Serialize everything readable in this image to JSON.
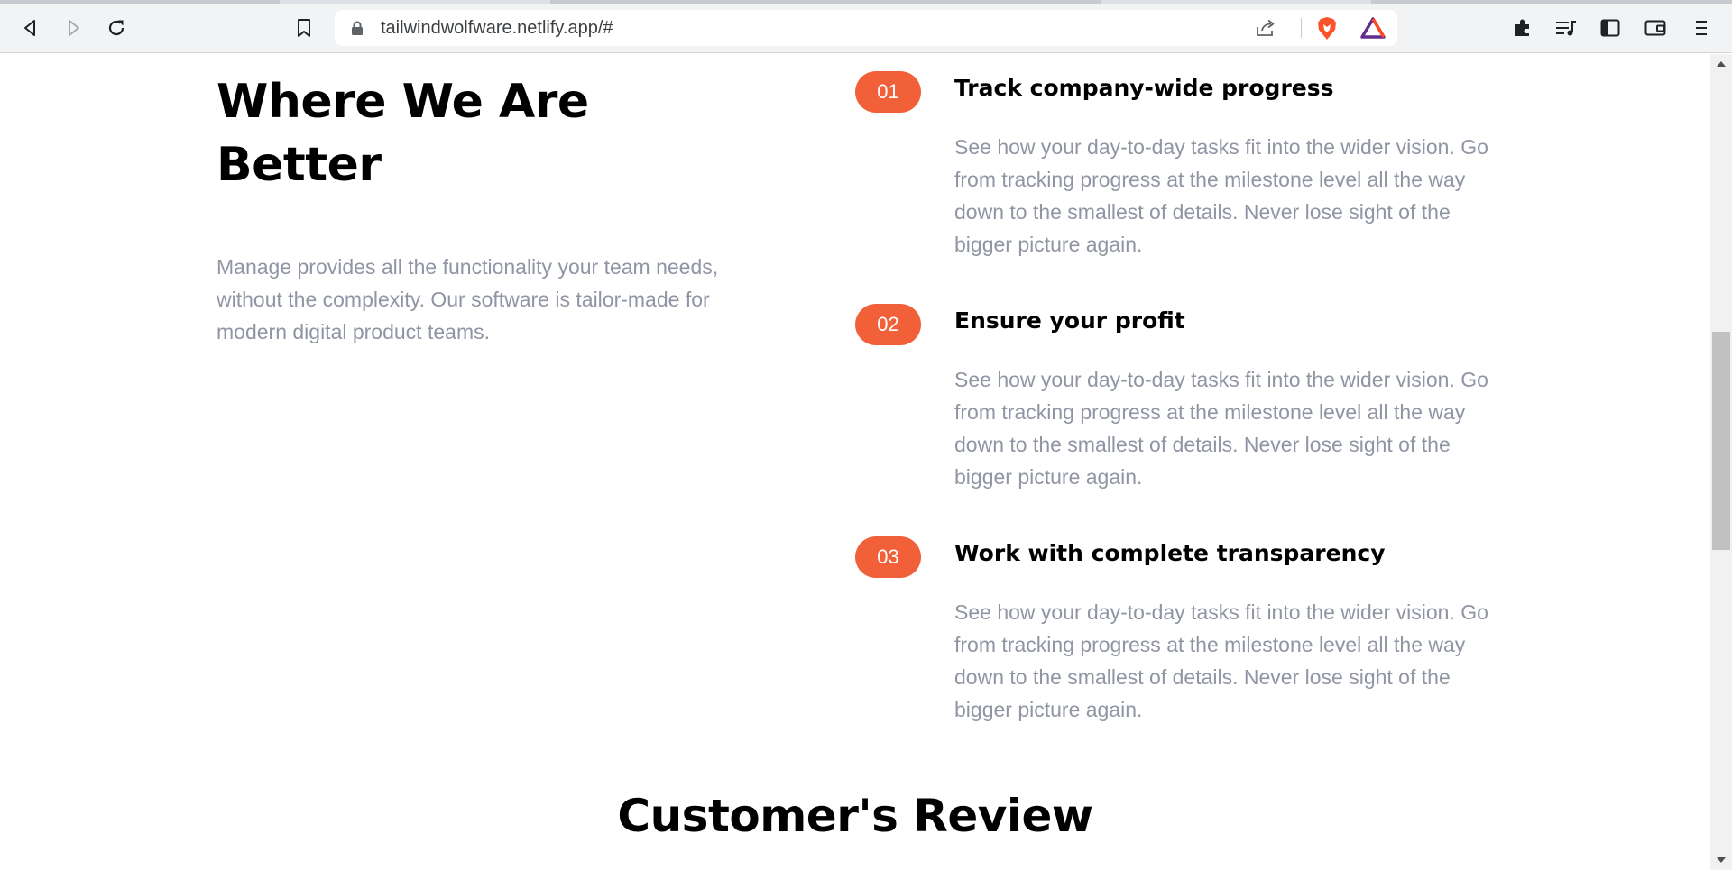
{
  "browser": {
    "url": "tailwindwolfware.netlify.app/#",
    "icons": {
      "back": "back-icon",
      "forward": "forward-icon",
      "reload": "reload-icon",
      "bookmark": "bookmark-icon",
      "lock": "lock-icon",
      "share": "share-icon",
      "brave_shields": "brave-shields-icon",
      "brave_rewards": "brave-rewards-icon",
      "extensions": "extensions-icon",
      "media": "media-playlist-icon",
      "sidebar": "sidebar-icon",
      "wallet": "wallet-icon",
      "menu": "menu-icon"
    }
  },
  "better_section": {
    "title": "Where We Are Better",
    "description": "Manage provides all the functionality your team needs, without the complexity. Our software is tailor-made for modern digital product teams.",
    "features": [
      {
        "number": "01",
        "title": "Track company-wide progress",
        "description": "See how your day-to-day tasks fit into the wider vision. Go from tracking progress at the milestone level all the way down to the smallest of details. Never lose sight of the bigger picture again."
      },
      {
        "number": "02",
        "title": "Ensure your profit",
        "description": "See how your day-to-day tasks fit into the wider vision. Go from tracking progress at the milestone level all the way down to the smallest of details. Never lose sight of the bigger picture again."
      },
      {
        "number": "03",
        "title": "Work with complete transparency",
        "description": "See how your day-to-day tasks fit into the wider vision. Go from tracking progress at the milestone level all the way down to the smallest of details. Never lose sight of the bigger picture again."
      }
    ]
  },
  "review_section": {
    "title": "Customer's Review"
  },
  "colors": {
    "accent": "#f2603a",
    "heading": "#000000",
    "muted_text": "#9095a3",
    "chrome_bg": "#f1f3f4"
  }
}
